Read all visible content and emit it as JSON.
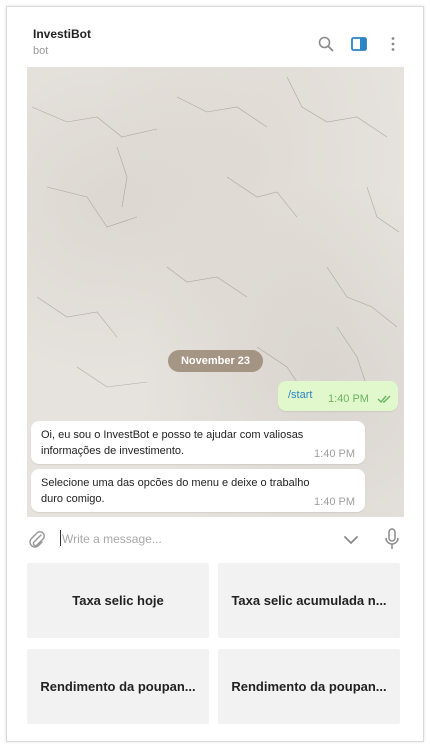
{
  "header": {
    "title": "InvestiBot",
    "subtitle": "bot",
    "icons": [
      "search-icon",
      "sidebar-toggle-icon",
      "more-vertical-icon"
    ]
  },
  "chat": {
    "date_label": "November 23",
    "outgoing": {
      "text": "/start",
      "time": "1:40 PM",
      "status_icon": "double-check-icon"
    },
    "incoming": [
      {
        "text": "Oi, eu sou o InvestBot e posso te ajudar com valiosas informações de investimento.",
        "time": "1:40 PM"
      },
      {
        "text": "Selecione uma das opcões do menu e deixe o trabalho duro comigo.",
        "time": "1:40 PM"
      }
    ]
  },
  "composer": {
    "placeholder": "Write a message...",
    "icons": [
      "attach-icon",
      "chevron-down-icon",
      "microphone-icon"
    ]
  },
  "keyboard": {
    "buttons": [
      "Taxa selic hoje",
      "Taxa selic acumulada n...",
      "Rendimento da poupan...",
      "Rendimento da poupan..."
    ]
  },
  "colors": {
    "accent": "#2a84c6",
    "outgoing_bubble": "#e1f8cc",
    "check": "#6bb45e"
  }
}
